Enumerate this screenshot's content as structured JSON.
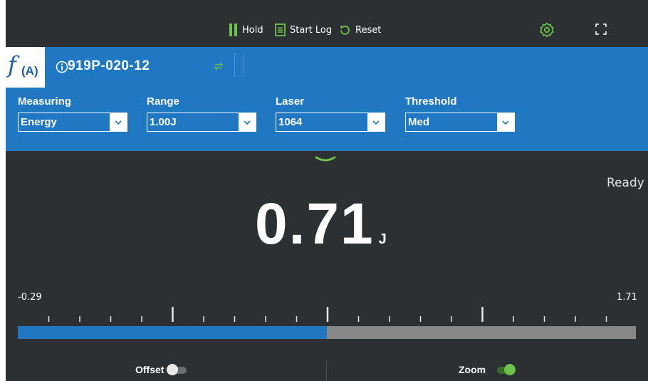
{
  "toolbar": {
    "hold_label": "Hold",
    "start_log_label": "Start Log",
    "reset_label": "Reset",
    "settings_icon": "gear-icon",
    "fullscreen_icon": "expand-icon"
  },
  "header": {
    "logo_f": "f",
    "logo_sub": "(A)",
    "sensor_name": "919P-020-12",
    "fields": [
      {
        "label": "Measuring",
        "value": "Energy"
      },
      {
        "label": "Range",
        "value": "1.00J"
      },
      {
        "label": "Laser",
        "value": "1064"
      },
      {
        "label": "Threshold",
        "value": "Med"
      }
    ]
  },
  "display": {
    "status": "Ready",
    "value": "0.71",
    "unit": "J",
    "scale_min": "-0.29",
    "scale_max": "1.71",
    "bar_fraction": 0.5
  },
  "bottom": {
    "offset_label": "Offset",
    "offset_on": false,
    "zoom_label": "Zoom",
    "zoom_on": true
  },
  "colors": {
    "header_blue": "#1f78c1",
    "accent_green": "#6cc24a",
    "background_dark": "#2c3033",
    "bar_gray": "#898888"
  }
}
